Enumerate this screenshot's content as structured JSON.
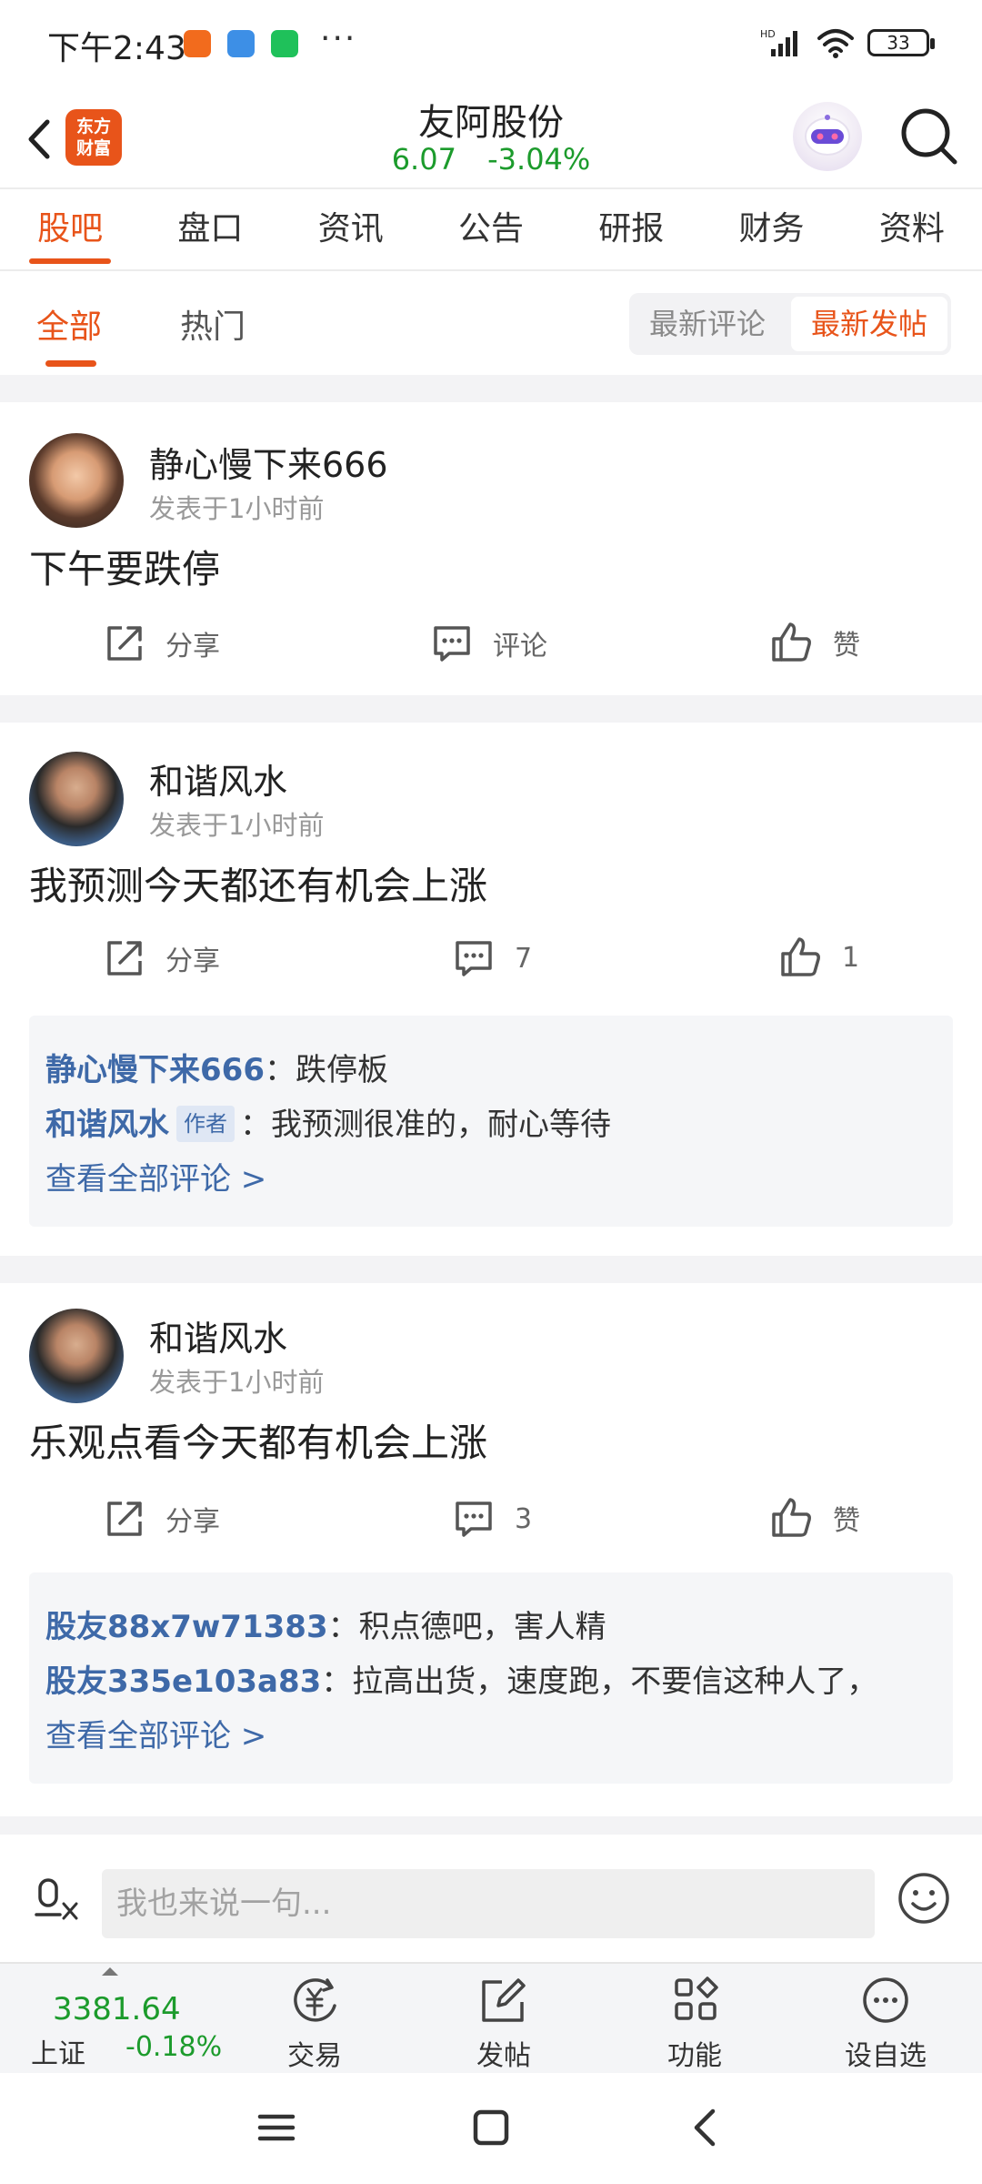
{
  "status_bar": {
    "time": "下午2:43",
    "more": "···",
    "battery": "33",
    "network": "HD"
  },
  "header": {
    "stock_name": "友阿股份",
    "price": "6.07",
    "change": "-3.04%",
    "logo_text": [
      "东方",
      "财富"
    ],
    "down_color": "#1c9b2c",
    "accent_color": "#e8541a"
  },
  "main_tabs": [
    {
      "label": "股吧",
      "active": true
    },
    {
      "label": "盘口"
    },
    {
      "label": "资讯"
    },
    {
      "label": "公告"
    },
    {
      "label": "研报"
    },
    {
      "label": "财务"
    },
    {
      "label": "资料"
    }
  ],
  "sub_tabs": {
    "all": "全部",
    "hot": "热门",
    "sort_latest_comment": "最新评论",
    "sort_latest_post": "最新发帖"
  },
  "posts": [
    {
      "author": "静心慢下来666",
      "time": "发表于1小时前",
      "content": "下午要跌停",
      "share": "分享",
      "comment": "评论",
      "like": "赞"
    },
    {
      "author": "和谐风水",
      "time": "发表于1小时前",
      "content": "我预测今天都还有机会上涨",
      "share": "分享",
      "comment": "7",
      "like": "1",
      "comments": [
        {
          "name": "静心慢下来666",
          "text": "：跌停板"
        },
        {
          "name": "和谐风水",
          "badge": "作者",
          "text": "：我预测很准的，耐心等待"
        }
      ],
      "view_all": "查看全部评论 >"
    },
    {
      "author": "和谐风水",
      "time": "发表于1小时前",
      "content": "乐观点看今天都有机会上涨",
      "share": "分享",
      "comment": "3",
      "like": "赞",
      "comments": [
        {
          "name": "股友88x7w71383",
          "text": "：积点德吧，害人精"
        },
        {
          "name": "股友335e103a83",
          "text": "：拉高出货，速度跑，不要信这种人了，"
        }
      ],
      "view_all": "查看全部评论 >"
    }
  ],
  "input_bar": {
    "placeholder": "我也来说一句..."
  },
  "toolbar": {
    "index_value": "3381.64",
    "index_name": "上证",
    "index_change": "-0.18%",
    "trade": "交易",
    "post": "发帖",
    "functions": "功能",
    "add_watchlist": "设自选"
  }
}
